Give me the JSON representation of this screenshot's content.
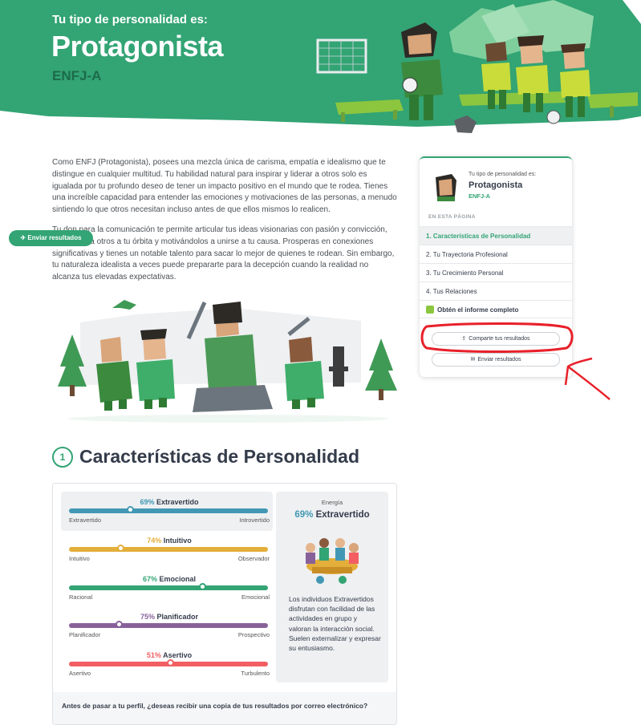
{
  "hero": {
    "subtitle": "Tu tipo de personalidad es:",
    "title": "Protagonista",
    "code": "ENFJ-A"
  },
  "intro": {
    "p1": "Como ENFJ (Protagonista), posees una mezcla única de carisma, empatía e idealismo que te distingue en cualquier multitud. Tu habilidad natural para inspirar y liderar a otros solo es igualada por tu profundo deseo de tener un impacto positivo en el mundo que te rodea. Tienes una increíble capacidad para entender las emociones y motivaciones de las personas, a menudo sintiendo lo que otros necesitan incluso antes de que ellos mismos lo realicen.",
    "p2": "Tu don para la comunicación te permite articular tus ideas visionarias con pasión y convicción, atrayendo a otros a tu órbita y motivándolos a unirse a tu causa. Prosperas en conexiones significativas y tienes un notable talento para sacar lo mejor de quienes te rodean. Sin embargo, tu naturaleza idealista a veces puede prepararte para la decepción cuando la realidad no alcanza tus elevadas expectativas."
  },
  "section": {
    "number": "1",
    "title": "Características de Personalidad"
  },
  "traits": [
    {
      "pct": "69%",
      "name": "Extravertido",
      "left": "Extravertido",
      "right": "Introvertido",
      "value": 0.31,
      "color": "#4298b4"
    },
    {
      "pct": "74%",
      "name": "Intuitivo",
      "left": "Intuitivo",
      "right": "Observador",
      "value": 0.26,
      "color": "#e4ae3a"
    },
    {
      "pct": "67%",
      "name": "Emocional",
      "left": "Racional",
      "right": "Emocional",
      "value": 0.67,
      "color": "#33a474"
    },
    {
      "pct": "75%",
      "name": "Planificador",
      "left": "Planificador",
      "right": "Prospectivo",
      "value": 0.25,
      "color": "#88619a"
    },
    {
      "pct": "51%",
      "name": "Asertivo",
      "left": "Asertivo",
      "right": "Turbulento",
      "value": 0.51,
      "color": "#f25e62"
    }
  ],
  "side_panel": {
    "category": "Energía",
    "pct": "69%",
    "name": "Extravertido",
    "description": "Los individuos Extravertidos disfrutan con facilidad de las actividades en grupo y valoran la interacción social. Suelen externalizar y expresar su entusiasmo."
  },
  "card_footer": {
    "question": "Antes de pasar a tu perfil, ¿deseas recibir una copia de tus resultados por correo electrónico?",
    "button": "Enviar resultados"
  },
  "widget": {
    "subtitle": "Tu tipo de personalidad es:",
    "title": "Protagonista",
    "code": "ENFJ-A",
    "section_label": "EN ESTA PÁGINA",
    "items": [
      "1. Características de Personalidad",
      "2. Tu Trayectoria Profesional",
      "3. Tu Crecimiento Personal",
      "4. Tus Relaciones",
      "Obtén el informe completo"
    ],
    "share_button": "Comparte tus resultados",
    "send_button": "Enviar resultados"
  },
  "colors": {
    "brand_green": "#33a474",
    "hero_green": "#33a474",
    "annotation_red": "#e8202a"
  },
  "icons": [
    "share-icon",
    "mail-icon",
    "send-icon",
    "report-icon"
  ]
}
